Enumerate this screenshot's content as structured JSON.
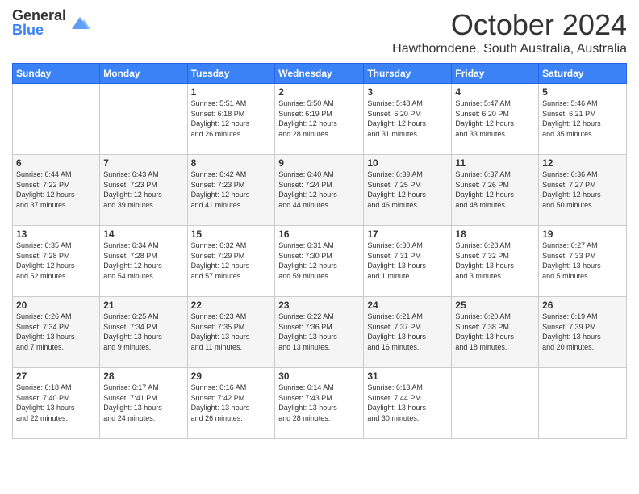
{
  "logo": {
    "general": "General",
    "blue": "Blue"
  },
  "header": {
    "month": "October 2024",
    "location": "Hawthorndene, South Australia, Australia"
  },
  "days_of_week": [
    "Sunday",
    "Monday",
    "Tuesday",
    "Wednesday",
    "Thursday",
    "Friday",
    "Saturday"
  ],
  "weeks": [
    [
      {
        "day": "",
        "info": ""
      },
      {
        "day": "",
        "info": ""
      },
      {
        "day": "1",
        "info": "Sunrise: 5:51 AM\nSunset: 6:18 PM\nDaylight: 12 hours\nand 26 minutes."
      },
      {
        "day": "2",
        "info": "Sunrise: 5:50 AM\nSunset: 6:19 PM\nDaylight: 12 hours\nand 28 minutes."
      },
      {
        "day": "3",
        "info": "Sunrise: 5:48 AM\nSunset: 6:20 PM\nDaylight: 12 hours\nand 31 minutes."
      },
      {
        "day": "4",
        "info": "Sunrise: 5:47 AM\nSunset: 6:20 PM\nDaylight: 12 hours\nand 33 minutes."
      },
      {
        "day": "5",
        "info": "Sunrise: 5:46 AM\nSunset: 6:21 PM\nDaylight: 12 hours\nand 35 minutes."
      }
    ],
    [
      {
        "day": "6",
        "info": "Sunrise: 6:44 AM\nSunset: 7:22 PM\nDaylight: 12 hours\nand 37 minutes."
      },
      {
        "day": "7",
        "info": "Sunrise: 6:43 AM\nSunset: 7:23 PM\nDaylight: 12 hours\nand 39 minutes."
      },
      {
        "day": "8",
        "info": "Sunrise: 6:42 AM\nSunset: 7:23 PM\nDaylight: 12 hours\nand 41 minutes."
      },
      {
        "day": "9",
        "info": "Sunrise: 6:40 AM\nSunset: 7:24 PM\nDaylight: 12 hours\nand 44 minutes."
      },
      {
        "day": "10",
        "info": "Sunrise: 6:39 AM\nSunset: 7:25 PM\nDaylight: 12 hours\nand 46 minutes."
      },
      {
        "day": "11",
        "info": "Sunrise: 6:37 AM\nSunset: 7:26 PM\nDaylight: 12 hours\nand 48 minutes."
      },
      {
        "day": "12",
        "info": "Sunrise: 6:36 AM\nSunset: 7:27 PM\nDaylight: 12 hours\nand 50 minutes."
      }
    ],
    [
      {
        "day": "13",
        "info": "Sunrise: 6:35 AM\nSunset: 7:28 PM\nDaylight: 12 hours\nand 52 minutes."
      },
      {
        "day": "14",
        "info": "Sunrise: 6:34 AM\nSunset: 7:28 PM\nDaylight: 12 hours\nand 54 minutes."
      },
      {
        "day": "15",
        "info": "Sunrise: 6:32 AM\nSunset: 7:29 PM\nDaylight: 12 hours\nand 57 minutes."
      },
      {
        "day": "16",
        "info": "Sunrise: 6:31 AM\nSunset: 7:30 PM\nDaylight: 12 hours\nand 59 minutes."
      },
      {
        "day": "17",
        "info": "Sunrise: 6:30 AM\nSunset: 7:31 PM\nDaylight: 13 hours\nand 1 minute."
      },
      {
        "day": "18",
        "info": "Sunrise: 6:28 AM\nSunset: 7:32 PM\nDaylight: 13 hours\nand 3 minutes."
      },
      {
        "day": "19",
        "info": "Sunrise: 6:27 AM\nSunset: 7:33 PM\nDaylight: 13 hours\nand 5 minutes."
      }
    ],
    [
      {
        "day": "20",
        "info": "Sunrise: 6:26 AM\nSunset: 7:34 PM\nDaylight: 13 hours\nand 7 minutes."
      },
      {
        "day": "21",
        "info": "Sunrise: 6:25 AM\nSunset: 7:34 PM\nDaylight: 13 hours\nand 9 minutes."
      },
      {
        "day": "22",
        "info": "Sunrise: 6:23 AM\nSunset: 7:35 PM\nDaylight: 13 hours\nand 11 minutes."
      },
      {
        "day": "23",
        "info": "Sunrise: 6:22 AM\nSunset: 7:36 PM\nDaylight: 13 hours\nand 13 minutes."
      },
      {
        "day": "24",
        "info": "Sunrise: 6:21 AM\nSunset: 7:37 PM\nDaylight: 13 hours\nand 16 minutes."
      },
      {
        "day": "25",
        "info": "Sunrise: 6:20 AM\nSunset: 7:38 PM\nDaylight: 13 hours\nand 18 minutes."
      },
      {
        "day": "26",
        "info": "Sunrise: 6:19 AM\nSunset: 7:39 PM\nDaylight: 13 hours\nand 20 minutes."
      }
    ],
    [
      {
        "day": "27",
        "info": "Sunrise: 6:18 AM\nSunset: 7:40 PM\nDaylight: 13 hours\nand 22 minutes."
      },
      {
        "day": "28",
        "info": "Sunrise: 6:17 AM\nSunset: 7:41 PM\nDaylight: 13 hours\nand 24 minutes."
      },
      {
        "day": "29",
        "info": "Sunrise: 6:16 AM\nSunset: 7:42 PM\nDaylight: 13 hours\nand 26 minutes."
      },
      {
        "day": "30",
        "info": "Sunrise: 6:14 AM\nSunset: 7:43 PM\nDaylight: 13 hours\nand 28 minutes."
      },
      {
        "day": "31",
        "info": "Sunrise: 6:13 AM\nSunset: 7:44 PM\nDaylight: 13 hours\nand 30 minutes."
      },
      {
        "day": "",
        "info": ""
      },
      {
        "day": "",
        "info": ""
      }
    ]
  ]
}
